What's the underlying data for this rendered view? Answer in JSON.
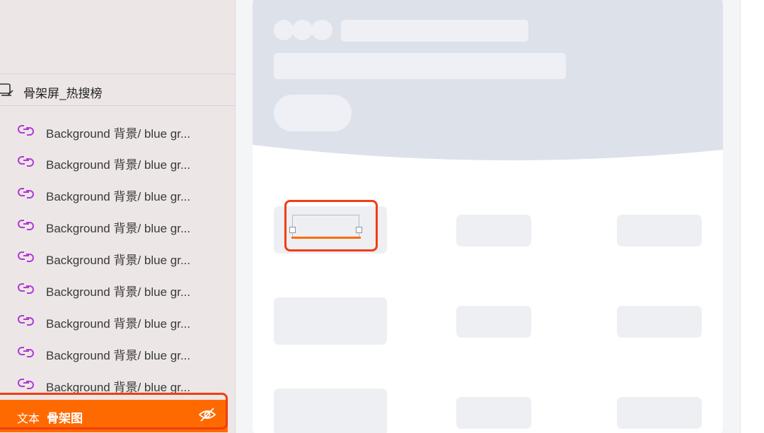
{
  "sidebar": {
    "group": {
      "label": "骨架屏_热搜榜",
      "icon": "component-group-icon"
    },
    "layers": [
      {
        "label": "Background 背景/ blue gr...",
        "icon": "symbol-link-icon"
      },
      {
        "label": "Background 背景/ blue gr...",
        "icon": "symbol-link-icon"
      },
      {
        "label": "Background 背景/ blue gr...",
        "icon": "symbol-link-icon"
      },
      {
        "label": "Background 背景/ blue gr...",
        "icon": "symbol-link-icon"
      },
      {
        "label": "Background 背景/ blue gr...",
        "icon": "symbol-link-icon"
      },
      {
        "label": "Background 背景/ blue gr...",
        "icon": "symbol-link-icon"
      },
      {
        "label": "Background 背景/ blue gr...",
        "icon": "symbol-link-icon"
      },
      {
        "label": "Background 背景/ blue gr...",
        "icon": "symbol-link-icon"
      },
      {
        "label": "Background 背景/ blue gr...",
        "icon": "symbol-link-icon"
      }
    ],
    "selected_layer": {
      "type_label": "文本",
      "name": "骨架图",
      "icon": "eye-hidden-icon"
    }
  },
  "colors": {
    "accent": "#ff6a00",
    "highlight_frame": "#f23d12",
    "link_icon": "#b23ad6",
    "sidebar_bg": "#ece6e6",
    "skeleton_fill": "#edeff3",
    "header_fill": "#dde1ea"
  }
}
